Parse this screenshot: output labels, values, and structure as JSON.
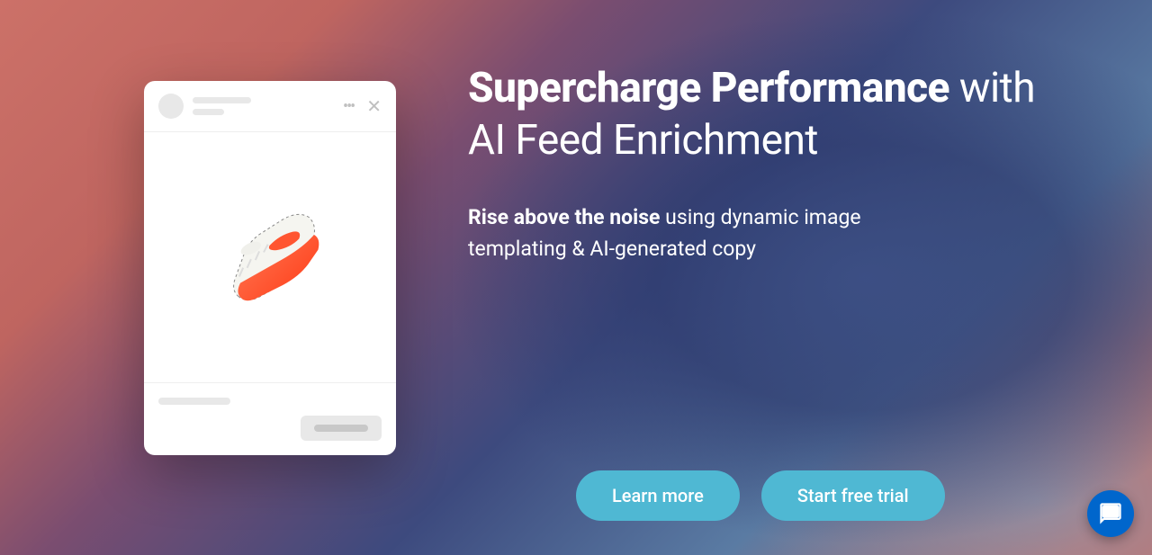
{
  "heading": {
    "bold": "Supercharge Performance",
    "rest1": " with",
    "rest2": "AI Feed Enrichment"
  },
  "subheading": {
    "bold": "Rise above the noise",
    "rest": " using dynamic image templating & AI-generated copy"
  },
  "buttons": {
    "learn_more": "Learn more",
    "start_trial": "Start free trial"
  },
  "icons": {
    "chat": "chat-icon",
    "close": "close-icon",
    "more": "more-dots-icon"
  }
}
